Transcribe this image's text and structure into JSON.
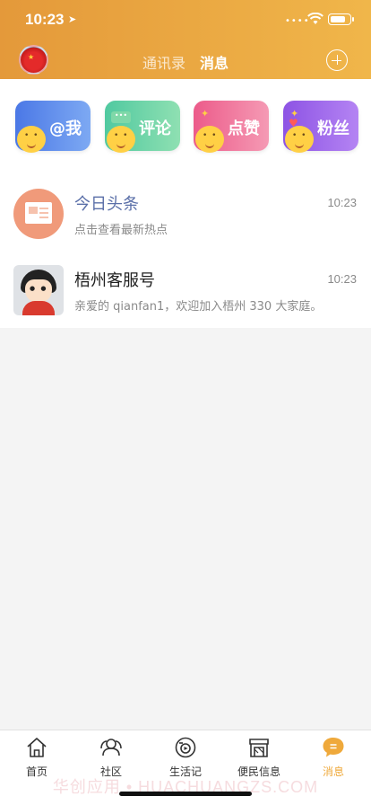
{
  "status_bar": {
    "time": "10:23",
    "battery_level": 0.8
  },
  "header": {
    "tabs": [
      {
        "label": "通讯录"
      },
      {
        "label": "消息"
      }
    ],
    "active_tab": "消息"
  },
  "quick_actions": [
    {
      "label": "@我",
      "color": "#4b78e6"
    },
    {
      "label": "评论",
      "color": "#50c9a0"
    },
    {
      "label": "点赞",
      "color": "#ec5b8a"
    },
    {
      "label": "粉丝",
      "color": "#8d53e4"
    }
  ],
  "messages": [
    {
      "title": "今日头条",
      "time": "10:23",
      "preview": "点击查看最新热点",
      "icon": "newspaper-icon"
    },
    {
      "title": "梧州客服号",
      "time": "10:23",
      "preview": "亲爱的 qianfan1，欢迎加入梧州 330 大家庭。",
      "icon": "service-avatar"
    }
  ],
  "bottom_nav": {
    "items": [
      {
        "label": "首页",
        "icon": "home-icon"
      },
      {
        "label": "社区",
        "icon": "community-icon"
      },
      {
        "label": "生活记",
        "icon": "life-record-icon"
      },
      {
        "label": "便民信息",
        "icon": "store-icon"
      },
      {
        "label": "消息",
        "icon": "message-icon"
      }
    ],
    "active": "消息",
    "active_color": "#efa93b"
  },
  "watermark": "华创应用 • HUACHUANGZS.COM"
}
